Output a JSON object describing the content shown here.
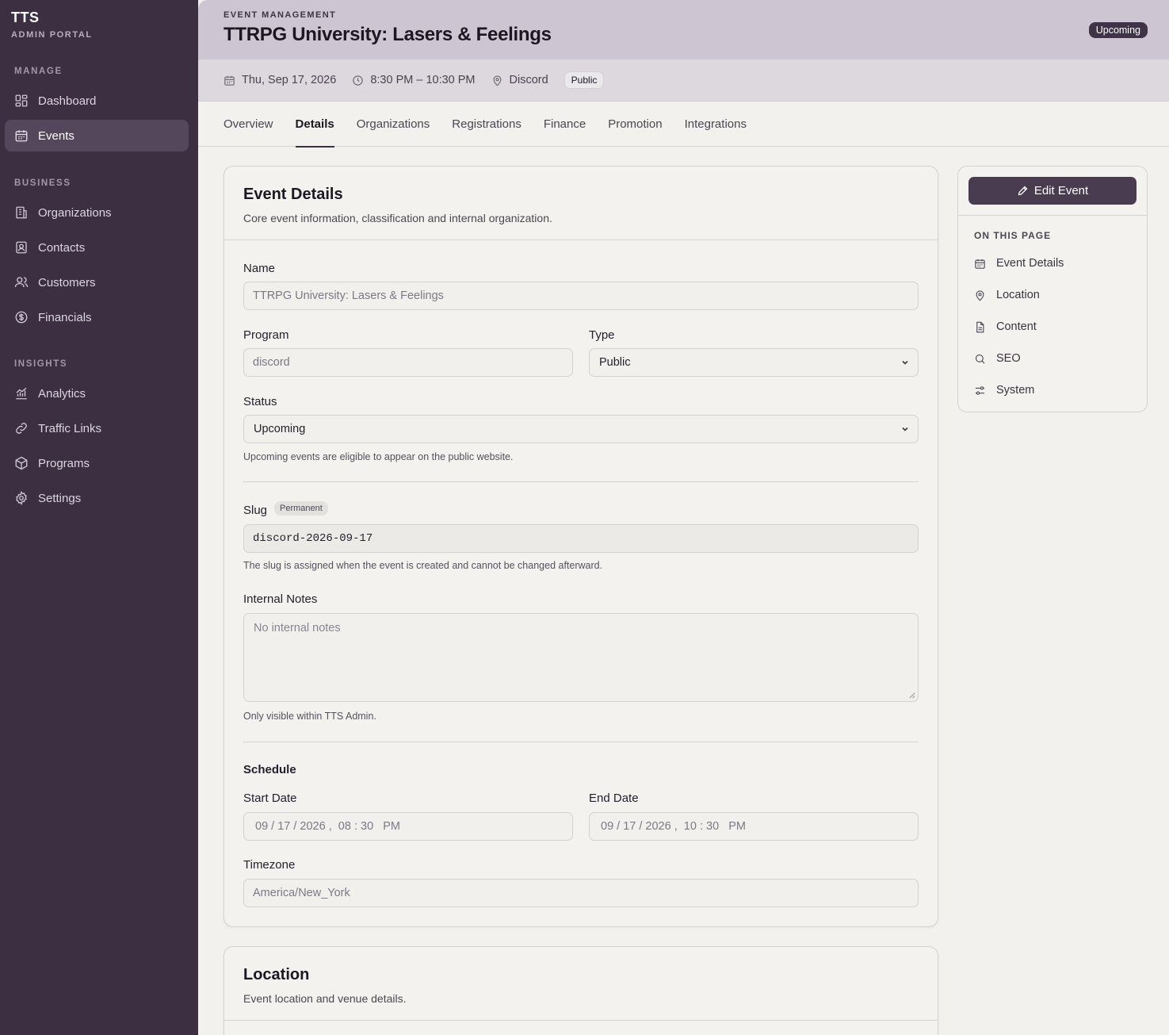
{
  "brand": {
    "name": "TTS",
    "subtitle": "ADMIN PORTAL"
  },
  "sidebar": {
    "sections": [
      {
        "title": "MANAGE"
      },
      {
        "title": "BUSINESS"
      },
      {
        "title": "INSIGHTS"
      }
    ],
    "items": [
      {
        "label": "Dashboard",
        "icon": "grid-icon"
      },
      {
        "label": "Events",
        "icon": "calendar-icon",
        "active": true
      },
      {
        "label": "Organizations",
        "icon": "building-icon"
      },
      {
        "label": "Contacts",
        "icon": "contact-icon"
      },
      {
        "label": "Customers",
        "icon": "users-icon"
      },
      {
        "label": "Financials",
        "icon": "dollar-icon"
      },
      {
        "label": "Analytics",
        "icon": "chart-icon"
      },
      {
        "label": "Traffic Links",
        "icon": "link-icon"
      },
      {
        "label": "Programs",
        "icon": "box-icon"
      },
      {
        "label": "Settings",
        "icon": "gear-icon"
      }
    ]
  },
  "header": {
    "eyebrow": "EVENT MANAGEMENT",
    "title": "TTRPG University: Lasers & Feelings",
    "status": "Upcoming"
  },
  "meta": {
    "date": "Thu, Sep 17, 2026",
    "time": "8:30 PM – 10:30 PM",
    "location": "Discord",
    "visibility": "Public"
  },
  "tabs": [
    {
      "label": "Overview"
    },
    {
      "label": "Details",
      "active": true
    },
    {
      "label": "Organizations"
    },
    {
      "label": "Registrations"
    },
    {
      "label": "Finance"
    },
    {
      "label": "Promotion"
    },
    {
      "label": "Integrations"
    }
  ],
  "details": {
    "title": "Event Details",
    "description": "Core event information, classification and internal organization.",
    "name_label": "Name",
    "name_value": "TTRPG University: Lasers & Feelings",
    "program_label": "Program",
    "program_value": "discord",
    "type_label": "Type",
    "type_value": "Public",
    "status_label": "Status",
    "status_value": "Upcoming",
    "status_hint": "Upcoming events are eligible to appear on the public website.",
    "slug_label": "Slug",
    "slug_badge": "Permanent",
    "slug_value": "discord-2026-09-17",
    "slug_hint": "The slug is assigned when the event is created and cannot be changed afterward.",
    "notes_label": "Internal Notes",
    "notes_placeholder": "No internal notes",
    "notes_hint": "Only visible within TTS Admin.",
    "schedule_label": "Schedule",
    "start_label": "Start Date",
    "start_value": "09 / 17 / 2026 ,  08 : 30   PM",
    "end_label": "End Date",
    "end_value": "09 / 17 / 2026 ,  10 : 30   PM",
    "timezone_label": "Timezone",
    "timezone_value": "America/New_York"
  },
  "location": {
    "title": "Location",
    "description": "Event location and venue details."
  },
  "right_panel": {
    "edit_label": "Edit Event",
    "heading": "ON THIS PAGE",
    "items": [
      {
        "label": "Event Details",
        "icon": "calendar-icon"
      },
      {
        "label": "Location",
        "icon": "map-pin-icon"
      },
      {
        "label": "Content",
        "icon": "document-icon"
      },
      {
        "label": "SEO",
        "icon": "search-icon"
      },
      {
        "label": "System",
        "icon": "sliders-icon"
      }
    ]
  }
}
